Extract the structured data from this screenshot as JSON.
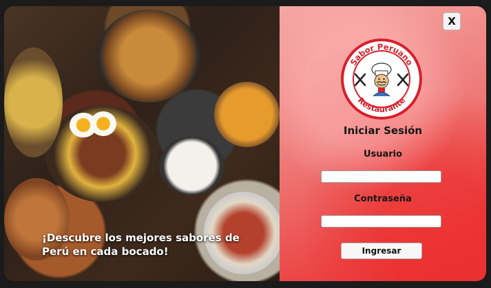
{
  "left_panel": {
    "tagline": "¡Descubre los mejores sabores de Perú en cada bocado!"
  },
  "logo": {
    "top_text": "Sabor Peruano",
    "bottom_text": "Restaurante",
    "ring_color": "#d81f2a",
    "icon": "chef-logo-icon"
  },
  "login": {
    "title": "Iniciar Sesión",
    "username_label": "Usuario",
    "username_value": "",
    "password_label": "Contraseña",
    "password_value": "",
    "submit_label": "Ingresar",
    "close_label": "X"
  },
  "colors": {
    "panel_top": "#f5a8a4",
    "panel_bottom": "#ea3535"
  }
}
